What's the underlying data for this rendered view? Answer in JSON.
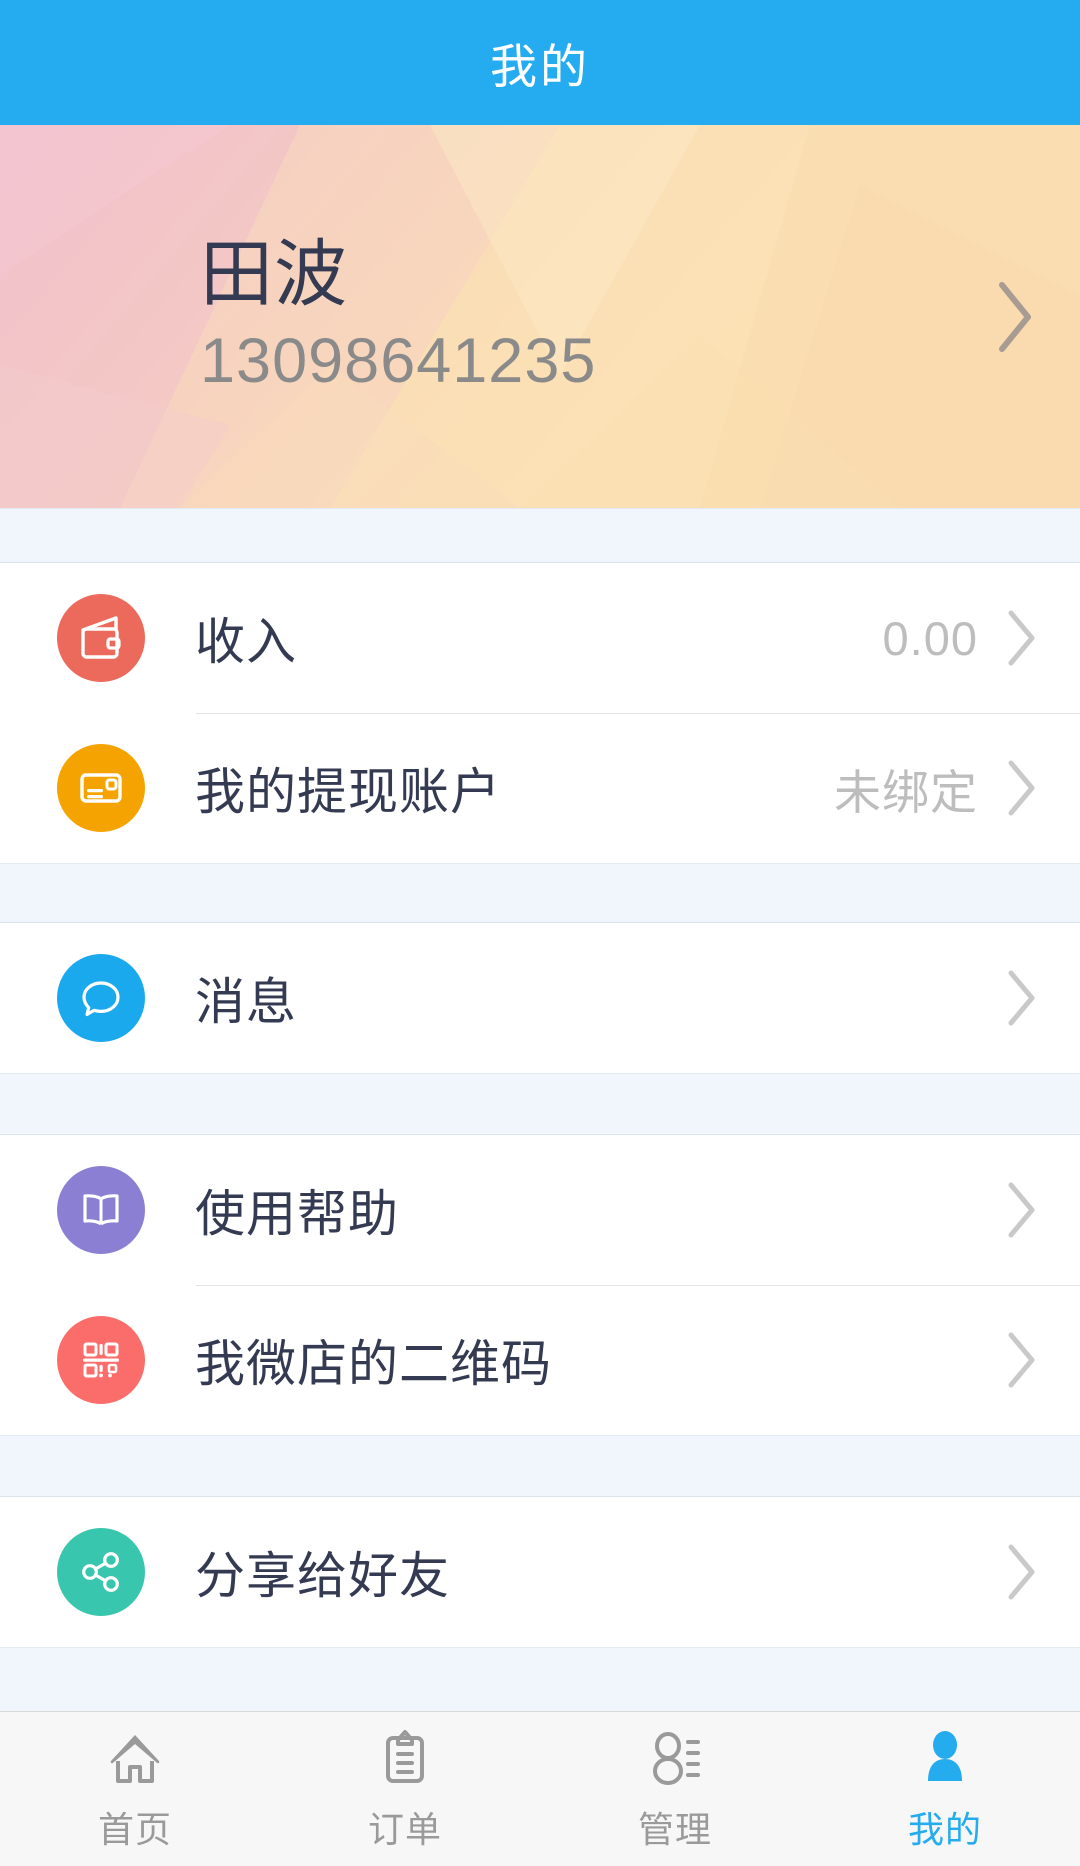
{
  "header": {
    "title": "我的",
    "background_color": "#25ABEF",
    "title_color": "#ffffff"
  },
  "profile": {
    "name": "田波",
    "phone": "13098641235",
    "arrow_icon": "chevron-right-icon",
    "name_color": "#343A52",
    "phone_color": "#8A8A8A",
    "background_colors": [
      "#F2C3CE",
      "#F9D7B6",
      "#FBE5BB",
      "#FAD9B4"
    ]
  },
  "sections": [
    {
      "rows": [
        {
          "icon": "wallet-icon",
          "icon_color": "#EC6A5C",
          "label": "收入",
          "value": "0.00",
          "arrow_icon": "chevron-right-icon"
        },
        {
          "icon": "bank-card-icon",
          "icon_color": "#F5A300",
          "label": "我的提现账户",
          "value": "未绑定",
          "arrow_icon": "chevron-right-icon"
        }
      ]
    },
    {
      "rows": [
        {
          "icon": "message-bubble-icon",
          "icon_color": "#1BA9EE",
          "label": "消息",
          "value": "",
          "arrow_icon": "chevron-right-icon"
        }
      ]
    },
    {
      "rows": [
        {
          "icon": "book-icon",
          "icon_color": "#8B7FD4",
          "label": "使用帮助",
          "value": "",
          "arrow_icon": "chevron-right-icon"
        },
        {
          "icon": "qrcode-icon",
          "icon_color": "#FB6D6A",
          "label": "我微店的二维码",
          "value": "",
          "arrow_icon": "chevron-right-icon"
        }
      ]
    },
    {
      "rows": [
        {
          "icon": "share-icon",
          "icon_color": "#38C6AE",
          "label": "分享给好友",
          "value": "",
          "arrow_icon": "chevron-right-icon"
        }
      ]
    }
  ],
  "tabbar": {
    "active_color": "#24ACEF",
    "inactive_color": "#9A9A9A",
    "items": [
      {
        "label": "首页",
        "icon": "home-icon",
        "active": false
      },
      {
        "label": "订单",
        "icon": "clipboard-icon",
        "active": false
      },
      {
        "label": "管理",
        "icon": "manage-user-icon",
        "active": false
      },
      {
        "label": "我的",
        "icon": "person-icon",
        "active": true
      }
    ]
  }
}
